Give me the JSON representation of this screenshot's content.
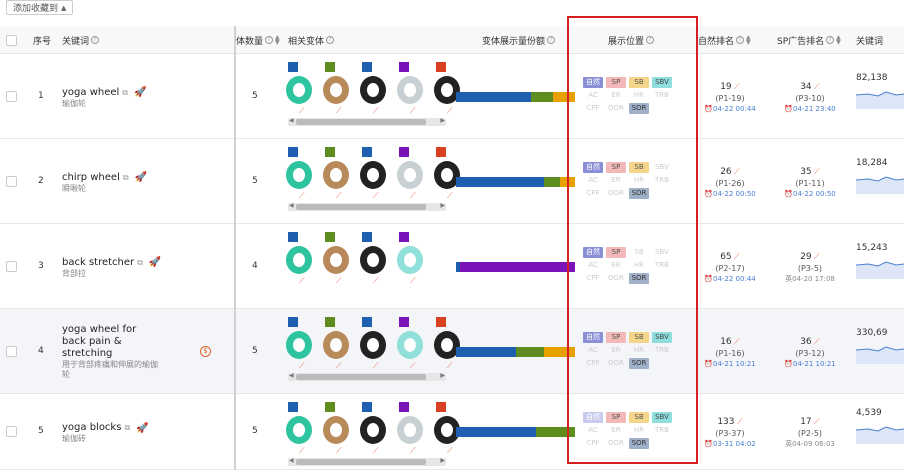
{
  "toolbar": {
    "add_label": "添加收藏到"
  },
  "header": {
    "col_index": "序号",
    "col_keyword": "关键词",
    "col_count": "体数量",
    "col_variants": "相关变体",
    "col_share": "变体展示量份额",
    "col_position": "展示位置",
    "col_natural": "自然排名",
    "col_sp": "SP广告排名",
    "col_trend": "关键词"
  },
  "tags": {
    "n": "自然",
    "sp": "SP",
    "sb": "SB",
    "sbv": "SBV",
    "ac": "AC",
    "er": "ER",
    "hr": "HR",
    "trb": "TRB",
    "cpf": "CPF",
    "oor": "OOR",
    "sor": "SOR"
  },
  "rows": [
    {
      "index": "1",
      "kw": "yoga wheel",
      "kwcn": "瑜伽轮",
      "count": "5",
      "natural_rank": "19",
      "natural_page": "(P1-19)",
      "natural_time": "04-22 00:44",
      "sp_rank": "34",
      "sp_page": "(P3-10)",
      "sp_time": "04-21 23:40",
      "volume": "82,138"
    },
    {
      "index": "2",
      "kw": "chirp wheel",
      "kwcn": "瞬啾轮",
      "count": "5",
      "natural_rank": "26",
      "natural_page": "(P1-26)",
      "natural_time": "04-22 00:50",
      "sp_rank": "35",
      "sp_page": "(P1-11)",
      "sp_time": "04-22 00:50",
      "volume": "18,284"
    },
    {
      "index": "3",
      "kw": "back stretcher",
      "kwcn": "背部拉",
      "count": "4",
      "natural_rank": "65",
      "natural_page": "(P2-17)",
      "natural_time": "04-22 00:44",
      "sp_rank": "29",
      "sp_page": "(P3-5)",
      "sp_time": "04-20 17:08",
      "volume": "15,243"
    },
    {
      "index": "4",
      "kw_lines": [
        "yoga wheel for",
        "back pain &",
        "stretching"
      ],
      "kwcn_lines": [
        "用于背部疼痛和伸展的瑜伽",
        "轮"
      ],
      "count": "5",
      "natural_rank": "16",
      "natural_page": "(P1-16)",
      "natural_time": "04-21 10:21",
      "sp_rank": "36",
      "sp_page": "(P3-12)",
      "sp_time": "04-21 10:21",
      "volume": "330,69"
    },
    {
      "index": "5",
      "kw": "yoga blocks",
      "kwcn": "瑜伽砖",
      "count": "5",
      "natural_rank": "133",
      "natural_page": "(P3-37)",
      "natural_time": "03-31 04:02",
      "sp_rank": "17",
      "sp_page": "(P2-5)",
      "sp_time": "04-09 06:03",
      "volume": "4,539"
    }
  ],
  "colors": {
    "blue": "#1f5fb0",
    "green": "#5e8c1e",
    "orange": "#e8a000",
    "purple": "#7a14b8",
    "red": "#d84020"
  }
}
